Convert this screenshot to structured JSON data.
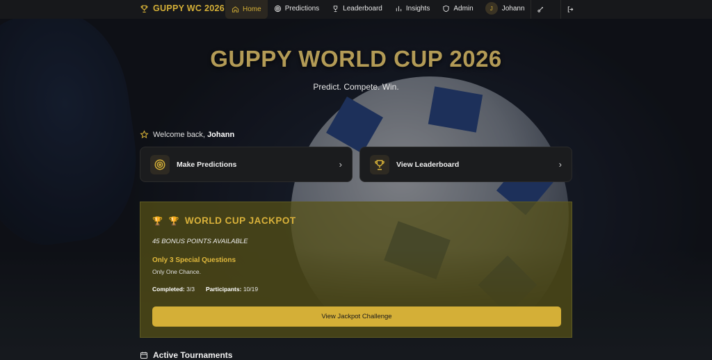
{
  "nav": {
    "brand": "GUPPY WC 2026",
    "items": [
      {
        "label": "Home",
        "icon": "home-icon",
        "active": true
      },
      {
        "label": "Predictions",
        "icon": "target-icon"
      },
      {
        "label": "Leaderboard",
        "icon": "trophy-icon"
      },
      {
        "label": "Insights",
        "icon": "bar-chart-icon"
      },
      {
        "label": "Admin",
        "icon": "shield-icon"
      }
    ],
    "user": {
      "initial": "J",
      "name": "Johann"
    }
  },
  "hero": {
    "title": "GUPPY WORLD CUP 2026",
    "subtitle": "Predict. Compete. Win."
  },
  "welcome": {
    "prefix": "Welcome back, ",
    "name": "Johann"
  },
  "cards": [
    {
      "label": "Make Predictions",
      "icon": "target-icon"
    },
    {
      "label": "View Leaderboard",
      "icon": "trophy-icon"
    }
  ],
  "jackpot": {
    "title": "WORLD CUP JACKPOT",
    "bonus": "45 BONUS POINTS AVAILABLE",
    "special": "Only 3 Special Questions",
    "once": "Only One Chance.",
    "completed_label": "Completed:",
    "completed_value": "3/3",
    "participants_label": "Participants:",
    "participants_value": "10/19",
    "button": "View Jackpot Challenge"
  },
  "section": {
    "title": "Active Tournaments"
  },
  "colors": {
    "accent": "#d4af37",
    "nav_bg": "#17181b",
    "card_bg": "#1b1c1e"
  }
}
